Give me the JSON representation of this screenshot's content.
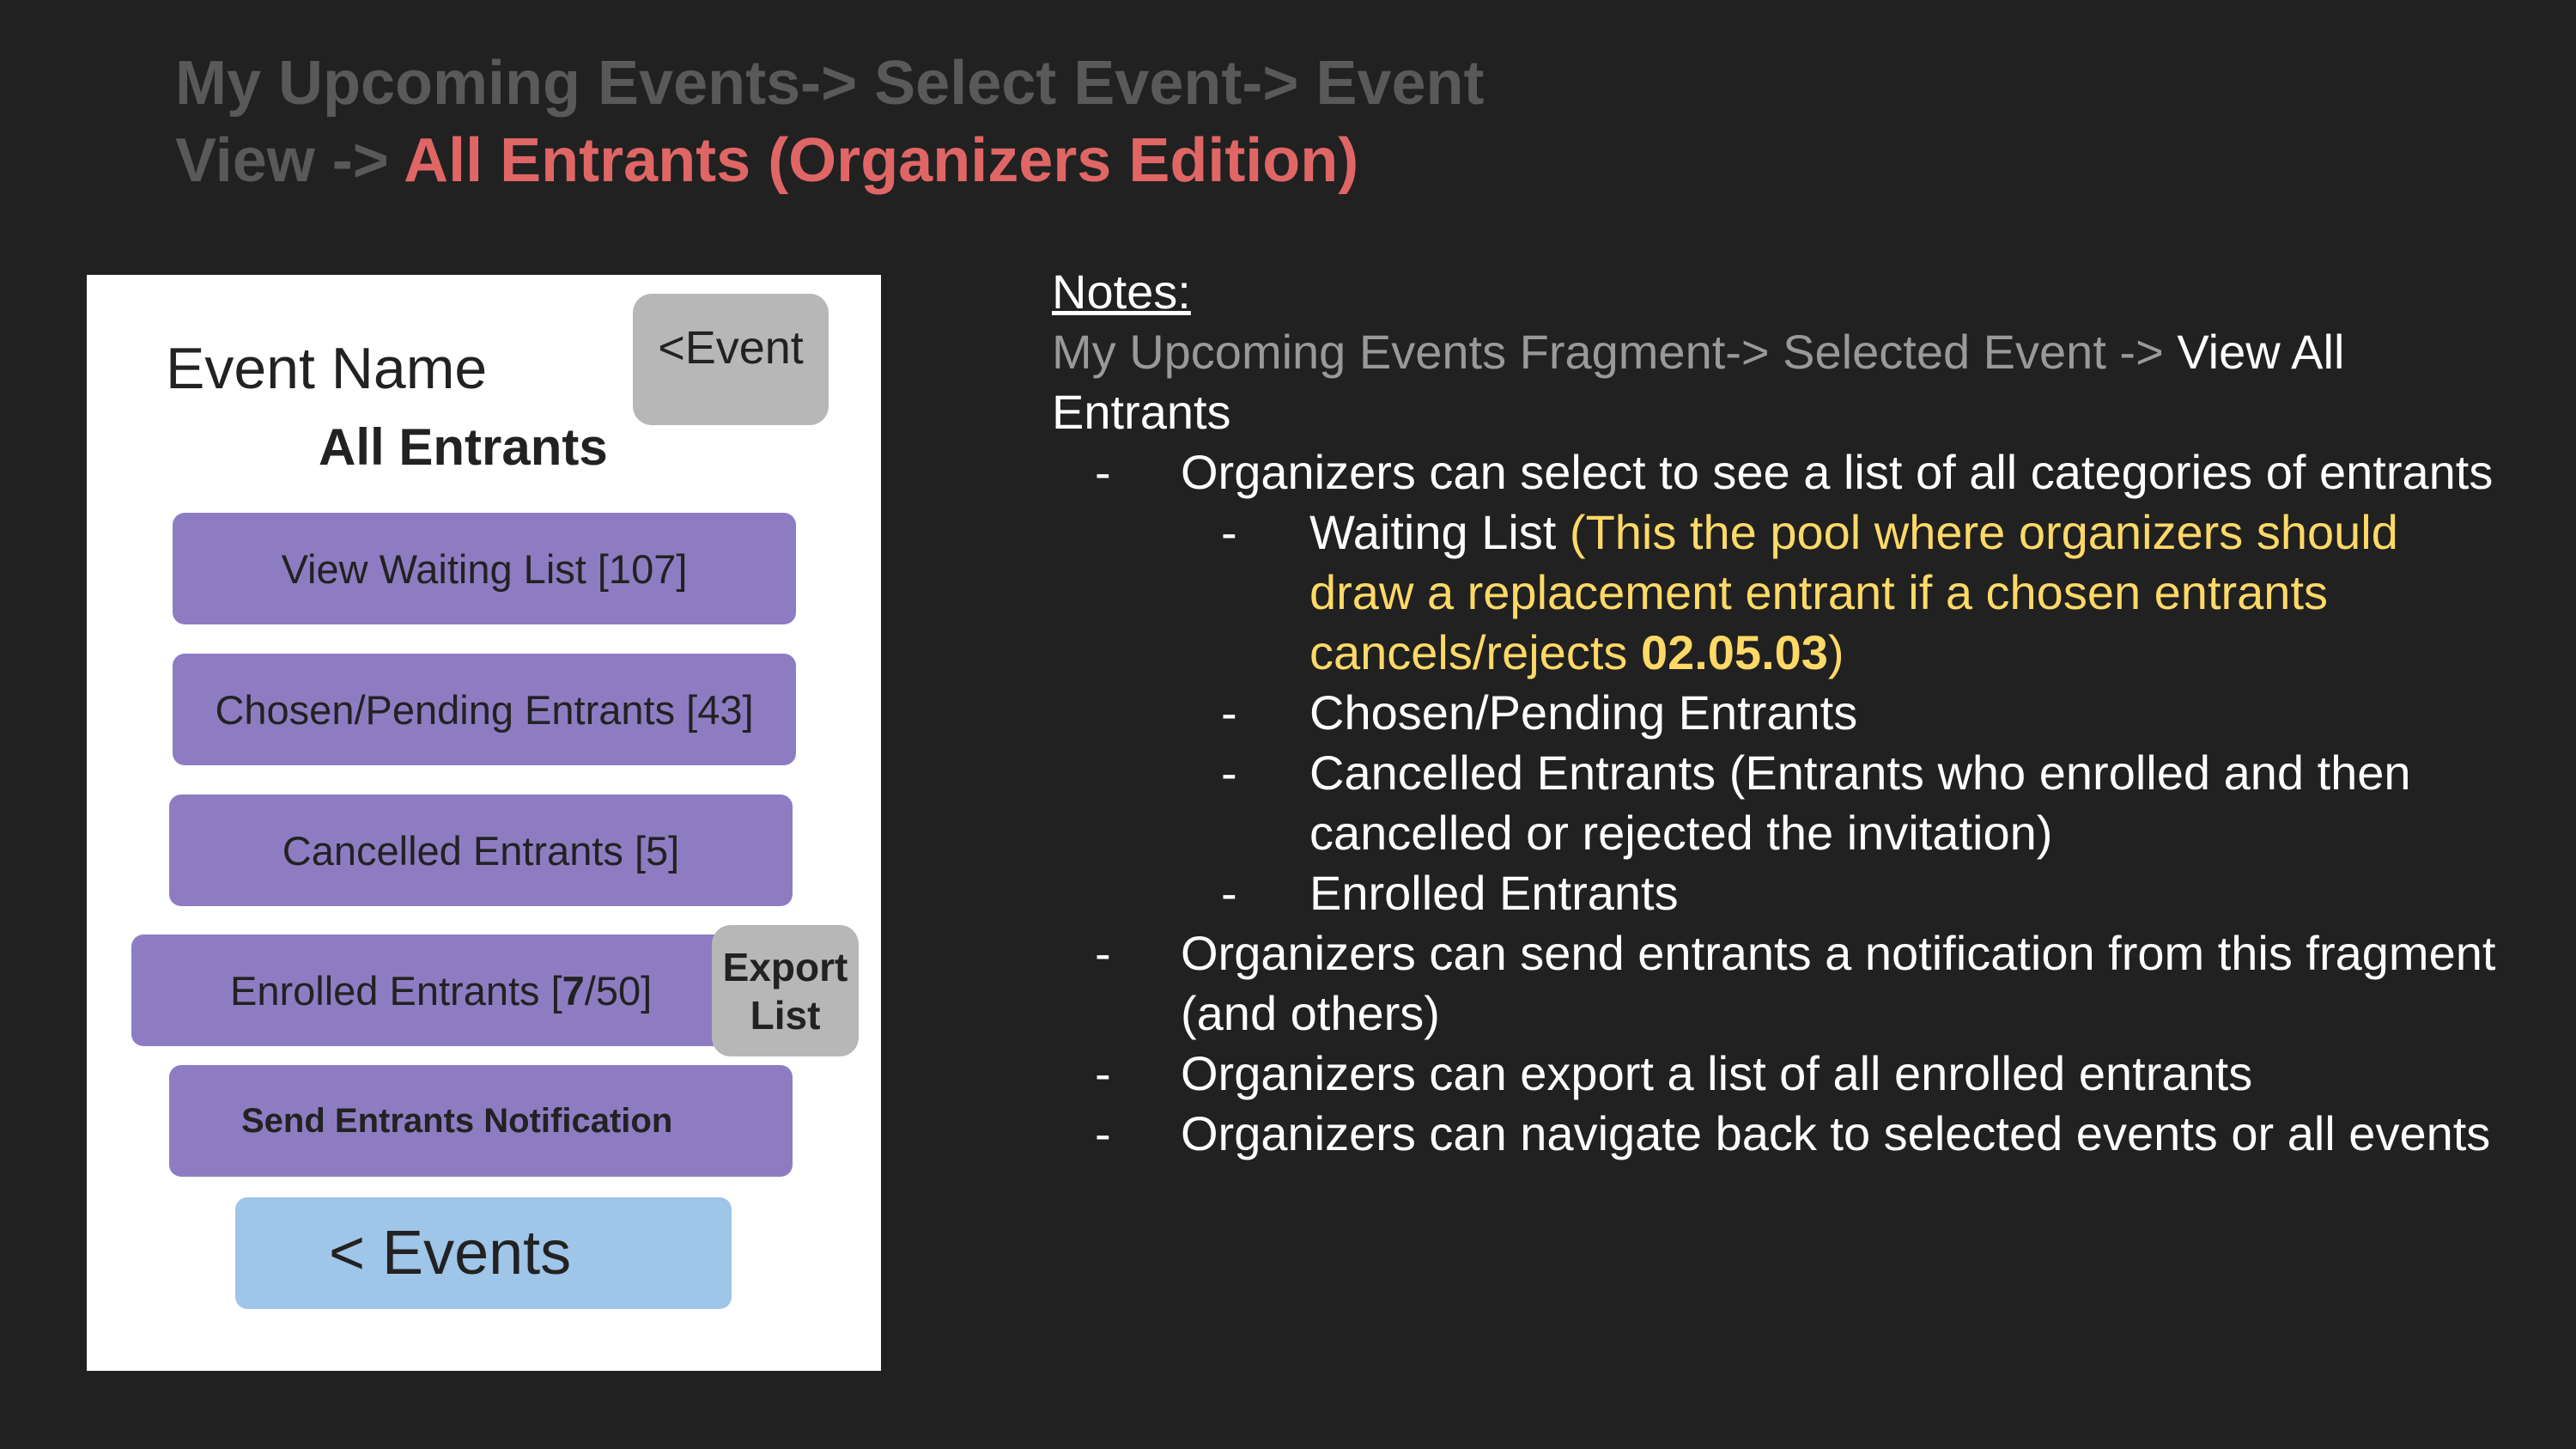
{
  "title": {
    "breadcrumb_prefix": "My Upcoming Events-> Select Event-> Event View -> ",
    "highlight": "All Entrants (Organizers Edition)"
  },
  "phone": {
    "event_name": "Event Name",
    "header": "All Entrants",
    "back_event_label": "<Event",
    "view_waiting_label": "View Waiting List [107]",
    "chosen_label": "Chosen/Pending Entrants [43]",
    "cancelled_label": "Cancelled Entrants [5]",
    "enrolled": {
      "prefix": "Enrolled Entrants [",
      "count": "7",
      "suffix": "/50]"
    },
    "export_line1": "Export",
    "export_line2": "List",
    "send_notification_label": "Send Entrants Notification",
    "events_back_label": "< Events"
  },
  "notes": {
    "heading": "Notes:",
    "path_grey": "My Upcoming Events Fragment-> Selected Event -> ",
    "path_white": "View All Entrants",
    "dash": "-",
    "item1": "Organizers can select to see a list of all categories of entrants",
    "sub1_label": "Waiting List ",
    "sub1_note": "(This the pool where organizers should draw a replacement entrant if a chosen entrants cancels/rejects ",
    "sub1_code": "02.05.03",
    "sub1_close": ")",
    "sub2": "Chosen/Pending Entrants",
    "sub3": "Cancelled Entrants (Entrants who enrolled and then cancelled or rejected the invitation)",
    "sub4": "Enrolled Entrants",
    "item2": "Organizers can send entrants a notification from this fragment (and others)",
    "item3": "Organizers can export a list of all enrolled entrants",
    "item4": "Organizers can navigate back to selected events or all events"
  }
}
